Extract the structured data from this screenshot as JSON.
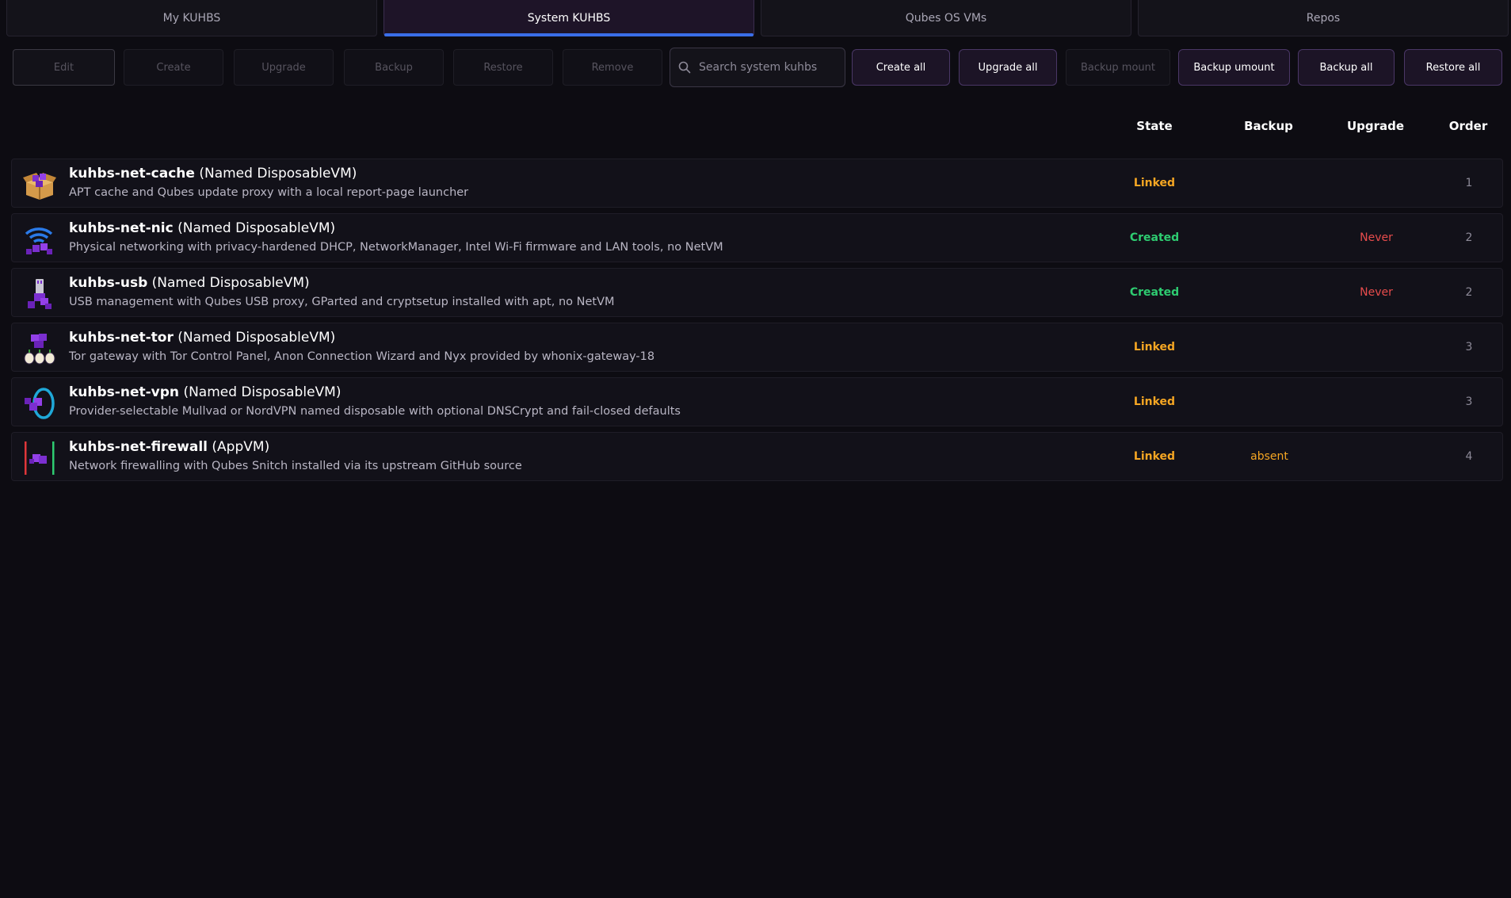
{
  "tabs": [
    {
      "label": "My KUHBS",
      "active": false
    },
    {
      "label": "System KUHBS",
      "active": true
    },
    {
      "label": "Qubes OS VMs",
      "active": false
    },
    {
      "label": "Repos",
      "active": false
    }
  ],
  "toolbar": {
    "edit": "Edit",
    "create": "Create",
    "upgrade": "Upgrade",
    "backup": "Backup",
    "restore": "Restore",
    "remove": "Remove",
    "search_placeholder": "Search system kuhbs",
    "search_value": "",
    "create_all": "Create all",
    "upgrade_all": "Upgrade all",
    "backup_mount": "Backup mount",
    "backup_umount": "Backup umount",
    "backup_all": "Backup all",
    "restore_all": "Restore all"
  },
  "columns": {
    "state": "State",
    "backup": "Backup",
    "upgrade": "Upgrade",
    "order": "Order"
  },
  "colors": {
    "accent": "#3a6ee8",
    "linked": "#f5a623",
    "created": "#2ecc71",
    "never": "#e74c4c",
    "absent": "#f5a623"
  },
  "rows": [
    {
      "name": "kuhbs-net-cache",
      "type": "(Named DisposableVM)",
      "desc": "APT cache and Qubes update proxy with a local report-page launcher",
      "state": "Linked",
      "backup": "",
      "upgrade": "",
      "order": "1",
      "icon": "package-box-icon"
    },
    {
      "name": "kuhbs-net-nic",
      "type": "(Named DisposableVM)",
      "desc": "Physical networking with privacy-hardened DHCP, NetworkManager, Intel Wi-Fi firmware and LAN tools, no NetVM",
      "state": "Created",
      "backup": "",
      "upgrade": "Never",
      "order": "2",
      "icon": "wifi-cubes-icon"
    },
    {
      "name": "kuhbs-usb",
      "type": "(Named DisposableVM)",
      "desc": "USB management with Qubes USB proxy, GParted and cryptsetup installed with apt, no NetVM",
      "state": "Created",
      "backup": "",
      "upgrade": "Never",
      "order": "2",
      "icon": "usb-stick-cubes-icon"
    },
    {
      "name": "kuhbs-net-tor",
      "type": "(Named DisposableVM)",
      "desc": "Tor gateway with Tor Control Panel, Anon Connection Wizard and Nyx provided by whonix-gateway-18",
      "state": "Linked",
      "backup": "",
      "upgrade": "",
      "order": "3",
      "icon": "tor-onion-cubes-icon"
    },
    {
      "name": "kuhbs-net-vpn",
      "type": "(Named DisposableVM)",
      "desc": "Provider-selectable Mullvad or NordVPN named disposable with optional DNSCrypt and fail-closed defaults",
      "state": "Linked",
      "backup": "",
      "upgrade": "",
      "order": "3",
      "icon": "vpn-ring-cubes-icon"
    },
    {
      "name": "kuhbs-net-firewall",
      "type": "(AppVM)",
      "desc": "Network firewalling with Qubes Snitch installed via its upstream GitHub source",
      "state": "Linked",
      "backup": "absent",
      "upgrade": "",
      "order": "4",
      "icon": "firewall-cubes-icon"
    }
  ]
}
